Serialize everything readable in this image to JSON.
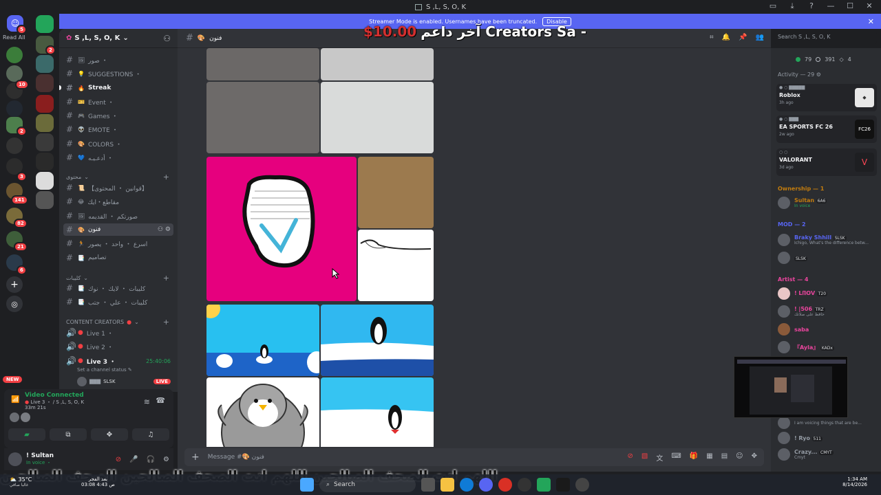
{
  "window": {
    "title": "S ,L, S, O, K"
  },
  "rail": {
    "read_all": "Read All",
    "badges": [
      "5",
      "2",
      "10",
      "2",
      "3",
      "141",
      "82",
      "21",
      "6"
    ]
  },
  "server": {
    "name": "S ,L, S, O, K"
  },
  "banner": {
    "text": "Streamer Mode is enabled. Usernames have been truncated.",
    "button": "Disable"
  },
  "overlay": {
    "title": "آخر داعم Creators Sa -",
    "price": "$10.00"
  },
  "channels": [
    {
      "name": "صور ・",
      "icon": "🖼",
      "hash": true,
      "style": "normal"
    },
    {
      "name": "SUGGESTIONS ・",
      "icon": "💡",
      "hash": true,
      "style": "normal"
    },
    {
      "name": "Streak",
      "icon": "🔥",
      "hash": true,
      "style": "bold"
    },
    {
      "name": "Event ・",
      "icon": "🎫",
      "hash": true,
      "style": "normal"
    },
    {
      "name": "Games ・",
      "icon": "🎮",
      "hash": true,
      "style": "normal"
    },
    {
      "name": "EMOTE ・",
      "icon": "👽",
      "hash": true,
      "style": "normal"
    },
    {
      "name": "COLORS ・",
      "icon": "🎨",
      "hash": true,
      "style": "normal"
    },
    {
      "name": "أدعـيـه ・",
      "icon": "💙",
      "hash": true,
      "style": "normal"
    }
  ],
  "cat_content": {
    "label": "محتوى"
  },
  "channels2": [
    {
      "name": "【قوانين ・ المحتوى】",
      "icon": "📜"
    },
    {
      "name": "مقاطع・ايك",
      "icon": "😂"
    },
    {
      "name": "صورتكم ・ القديمه",
      "icon": "🖼"
    },
    {
      "name": "فنون",
      "icon": "🎨",
      "selected": true
    },
    {
      "name": "اسرع ・ واحد ・ يصور",
      "icon": "🏃"
    },
    {
      "name": "تصاميم",
      "icon": "📑"
    }
  ],
  "cat_clips": {
    "label": "كليبات"
  },
  "channels3": [
    {
      "name": "كليبات ・ لايك ・ نوك",
      "icon": "📑"
    },
    {
      "name": "كليبات ・ علي ・ جتب",
      "icon": "📑"
    }
  ],
  "cat_creators": {
    "label": "CONTENT CREATORS"
  },
  "voice": [
    {
      "name": "Live 1 ・"
    },
    {
      "name": "Live 2 ・"
    },
    {
      "name": "Live 3 ・",
      "timer": "25:40:06"
    }
  ],
  "voice_status": "Set a channel status",
  "voice_user": {
    "tag": "SLSK",
    "live": "LIVE"
  },
  "new_badge": "NEW",
  "voice_panel": {
    "title": "Video Connected",
    "sub": "Live 3 ・ / S ,L, S, O, K",
    "time": "33m 21s"
  },
  "user": {
    "name": "! Sultan",
    "status": "In voice ・"
  },
  "chat": {
    "channel": "فنون",
    "composer_placeholder": "Message #🎨 فنون"
  },
  "search": {
    "placeholder": "Search S ,L, S, O, K"
  },
  "members": {
    "stats": [
      "79",
      "391",
      "4"
    ],
    "activity_head": "Activity — 29",
    "activities": [
      {
        "game": "Roblox",
        "ago": "3h ago",
        "thumb": ""
      },
      {
        "game": "EA SPORTS FC 26",
        "ago": "2w ago",
        "thumb": "FC26"
      },
      {
        "game": "VALORANT",
        "ago": "3d ago",
        "thumb": "V"
      }
    ],
    "roles": [
      {
        "label": "Ownership — 1",
        "color": "#c27c0e"
      },
      {
        "label": "MOD — 2",
        "color": "#5865f2"
      },
      {
        "label": "Artist — 4",
        "color": "#eb459e"
      }
    ],
    "list": [
      {
        "name": "Sultan",
        "tag": "6A6",
        "color": "#c27c0e",
        "sub": "In voice"
      },
      {
        "name": "Braky Shhill",
        "tag": "SLSK",
        "color": "#5865f2",
        "sub": "Ichigo, What's the difference betw..."
      },
      {
        "name": "",
        "tag": "SLSK",
        "color": "#5865f2",
        "sub": ""
      },
      {
        "name": "! ᒪᗰOᐯ",
        "tag": "T20",
        "color": "#eb459e",
        "sub": ""
      },
      {
        "name": "! |506",
        "tag": "TRZ",
        "color": "#eb459e",
        "sub": "حافظ على صلاتك"
      },
      {
        "name": "saba",
        "tag": "",
        "color": "#eb459e",
        "sub": ""
      },
      {
        "name": "『Ayla』",
        "tag": "KADx",
        "color": "#eb459e",
        "sub": ""
      },
      {
        "name": "",
        "tag": "",
        "color": "#949ba4",
        "sub": "I am voicing things that are be..."
      },
      {
        "name": "! Ryo",
        "tag": "511",
        "color": "#949ba4",
        "sub": ""
      },
      {
        "name": "Crazy...",
        "tag": "CMYT",
        "color": "#949ba4",
        "sub": "Cmyt"
      }
    ]
  },
  "overlay_arabic": "اللهم انت الصحف الصالحين   اللهم انت الصحف الصالحين   الصحف الصالحين",
  "taskbar": {
    "temp": "35°C",
    "weather": "غالبا صافي",
    "prayer": "الفجر",
    "prayer_left": "بعد",
    "prayer_time": "03:08",
    "prayer_time2": "4:43 ص",
    "search": "Search",
    "clock": "1:34 AM",
    "date": "8/14/2026"
  }
}
